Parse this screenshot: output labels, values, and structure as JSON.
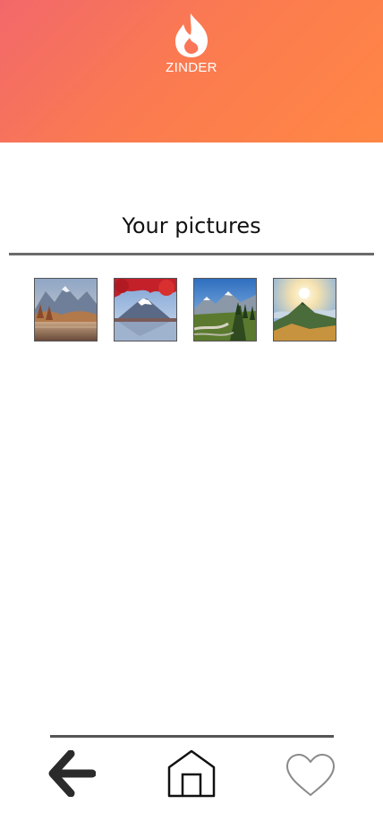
{
  "header": {
    "brand": "ZINDER",
    "logo_icon": "flame-icon",
    "gradient": [
      "#f2686b",
      "#fb7a51",
      "#ff8744"
    ]
  },
  "gallery": {
    "title": "Your pictures",
    "photos": [
      {
        "name": "photo-lake-autumn"
      },
      {
        "name": "photo-mount-fuji"
      },
      {
        "name": "photo-alpine-valley"
      },
      {
        "name": "photo-sunrise-hills"
      }
    ]
  },
  "nav": {
    "back_icon": "arrow-left-icon",
    "home_icon": "home-icon",
    "likes_icon": "heart-icon"
  }
}
